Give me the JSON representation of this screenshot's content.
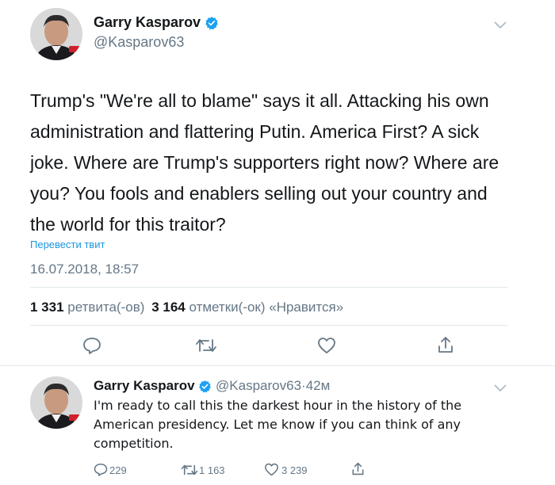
{
  "main_tweet": {
    "author_name": "Garry Kasparov",
    "author_handle": "@Kasparov63",
    "text": "Trump's \"We're all to blame\" says it all. Attacking his own administration and flattering Putin. America First? A sick joke. Where are Trump's supporters right now? Where are you? You fools and enablers selling out your country and the world for this traitor?",
    "translate_label": "Перевести твит",
    "timestamp": "16.07.2018, 18:57",
    "retweets_count": "1 331",
    "retweets_label": "ретвита(-ов)",
    "likes_count": "3 164",
    "likes_label": "отметки(-ок) «Нравится»",
    "icons": [
      "reply-icon",
      "retweet-icon",
      "like-icon",
      "share-icon"
    ]
  },
  "reply_tweet": {
    "author_name": "Garry Kasparov",
    "author_handle": "@Kasparov63",
    "separator": "·",
    "time": "42м",
    "text": "I'm ready to call this the darkest hour in the history of the American presidency. Let me know if you can think of any competition.",
    "reply_count": "229",
    "retweet_count": "1 163",
    "like_count": "3 239"
  },
  "colors": {
    "accent": "#1b95e0",
    "verified": "#1da1f2",
    "muted": "#657786",
    "divider": "#e1e8ed"
  }
}
